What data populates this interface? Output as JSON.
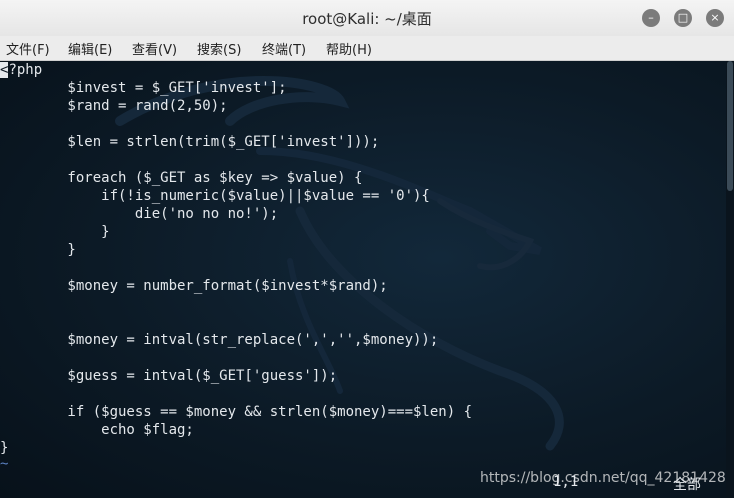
{
  "window": {
    "title": "root@Kali: ~/桌面",
    "controls": {
      "minimize": "–",
      "maximize": "□",
      "close": "×"
    }
  },
  "menu": {
    "items": [
      "文件(F)",
      "编辑(E)",
      "查看(V)",
      "搜索(S)",
      "终端(T)",
      "帮助(H)"
    ]
  },
  "editor": {
    "cursor_char": "<",
    "first_line_rest": "?php",
    "lines": [
      "        $invest = $_GET['invest'];",
      "        $rand = rand(2,50);",
      "",
      "        $len = strlen(trim($_GET['invest']));",
      "",
      "        foreach ($_GET as $key => $value) {",
      "            if(!is_numeric($value)||$value == '0'){",
      "                die('no no no!');",
      "            }",
      "        }",
      "",
      "        $money = number_format($invest*$rand);",
      "",
      "",
      "        $money = intval(str_replace(',','',$money));",
      "",
      "        $guess = intval($_GET['guess']);",
      "",
      "        if ($guess == $money && strlen($money)===$len) {",
      "            echo $flag;",
      "}"
    ],
    "tilde": "~",
    "status_position": "1,1",
    "status_all": "全部"
  },
  "watermark": "https://blog.csdn.net/qq_42181428",
  "colors": {
    "terminal_bg": "#0b1620",
    "text": "#e4e8ec",
    "tilde": "#5a7fbf",
    "titlebar": "#e6e6e6",
    "window_button": "#7b7b7b"
  }
}
